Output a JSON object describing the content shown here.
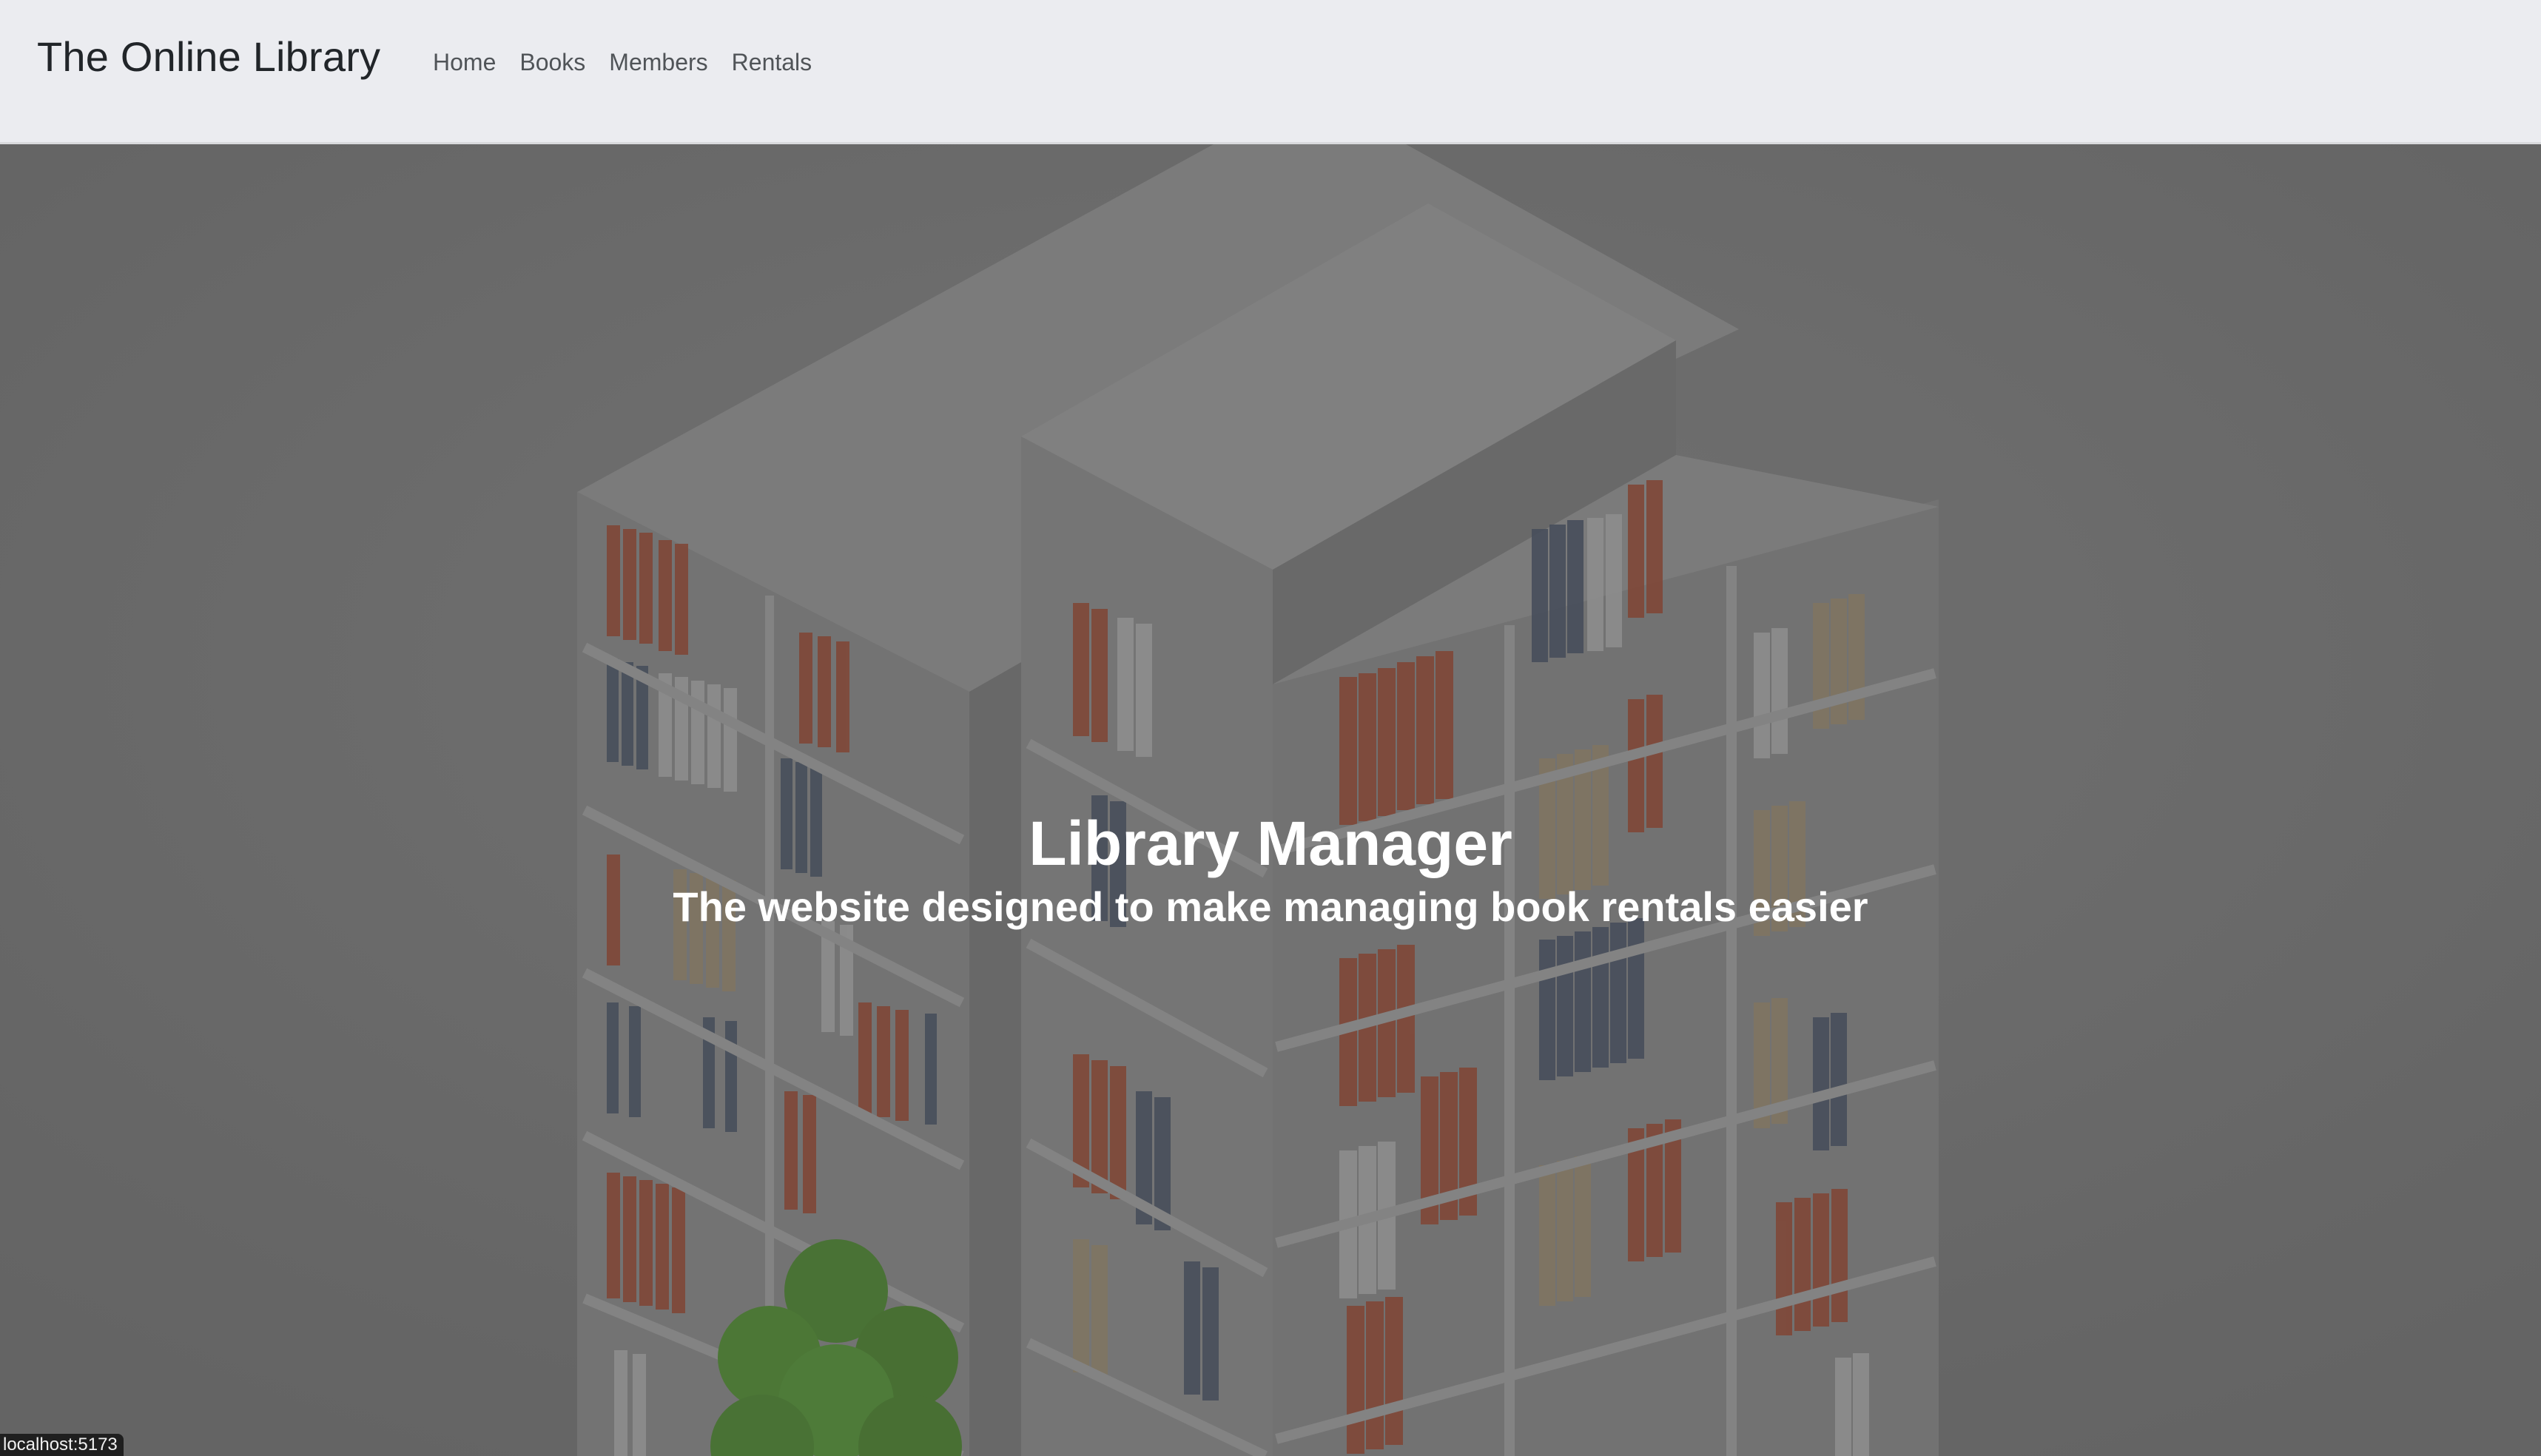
{
  "navbar": {
    "brand": "The Online Library",
    "links": [
      "Home",
      "Books",
      "Members",
      "Rentals"
    ]
  },
  "hero": {
    "title": "Library Manager",
    "subtitle": "The website designed to make managing book rentals easier",
    "image_description_icon": "bookshelf-illustration"
  },
  "status_bar": {
    "url": "localhost:5173"
  },
  "colors": {
    "navbar_bg": "#ebecf0",
    "hero_overlay": "#727272",
    "hero_text": "#ffffff",
    "brand_text": "#212529",
    "nav_link_text": "#505458"
  }
}
